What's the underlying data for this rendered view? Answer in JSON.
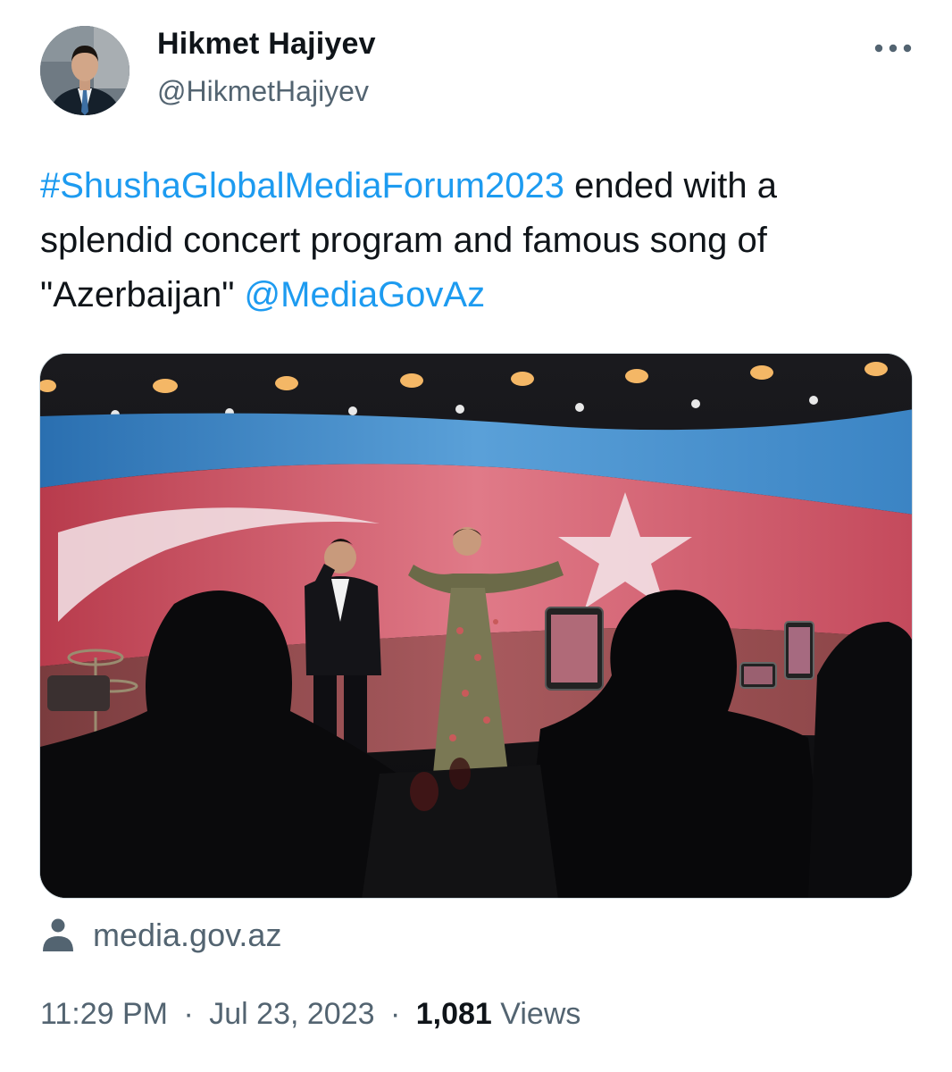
{
  "author": {
    "display_name": "Hikmet Hajiyev",
    "handle": "@HikmetHajiyev",
    "avatar_icon": "profile-photo"
  },
  "tweet": {
    "hashtag": "#ShushaGlobalMediaForum2023",
    "text_part1": " ended with a splendid concert program and famous song of \"Azerbaijan\" ",
    "mention": "@MediaGovAz",
    "image_icon": "concert-photo"
  },
  "source": {
    "icon": "person-icon",
    "label": "media.gov.az"
  },
  "meta": {
    "time": "11:29 PM",
    "separator": "·",
    "date": "Jul 23, 2023",
    "views_count": "1,081",
    "views_label": "Views"
  },
  "colors": {
    "link": "#1d9bf0",
    "text": "#0f1419",
    "secondary": "#536471"
  }
}
